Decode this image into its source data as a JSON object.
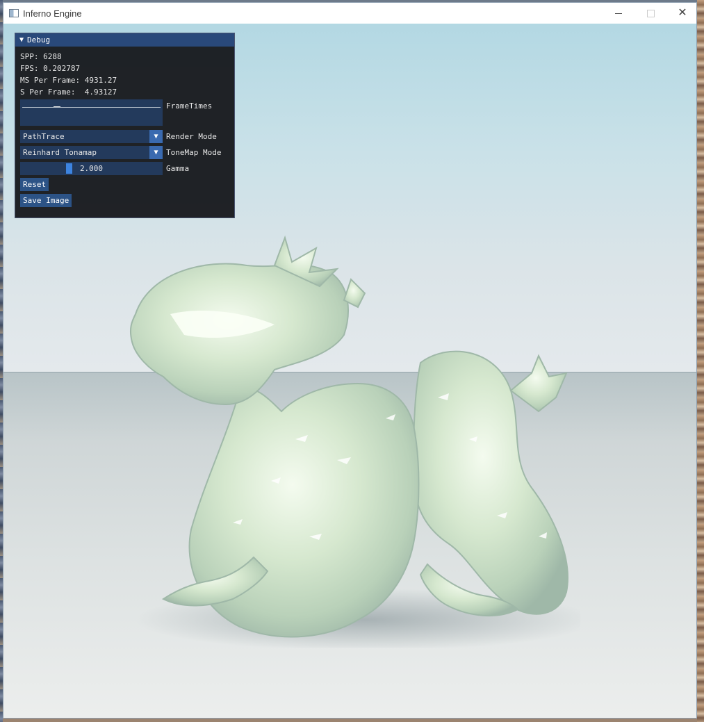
{
  "window": {
    "title": "Inferno Engine",
    "minimize_icon": "minimize-icon",
    "maximize_icon": "maximize-icon",
    "close_icon": "close-icon"
  },
  "debug": {
    "title": "Debug",
    "spp_text": "SPP: 6288",
    "fps_text": "FPS: 0.202787",
    "ms_text": "MS Per Frame: 4931.27",
    "s_text": "S Per Frame:  4.93127",
    "frametimes_label": "FrameTimes",
    "render_mode": {
      "value": "PathTrace",
      "label": "Render Mode"
    },
    "tonemap_mode": {
      "value": "Reinhard Tonamap",
      "label": "ToneMap Mode"
    },
    "gamma": {
      "value": 2.0,
      "display": "2.000",
      "label": "Gamma",
      "min": 0,
      "max": 5
    },
    "reset_label": "Reset",
    "save_label": "Save Image"
  },
  "colors": {
    "panel_header": "#29497a",
    "frame_bg": "#233a5c",
    "accent": "#3d84e0",
    "button": "#2c5386"
  }
}
